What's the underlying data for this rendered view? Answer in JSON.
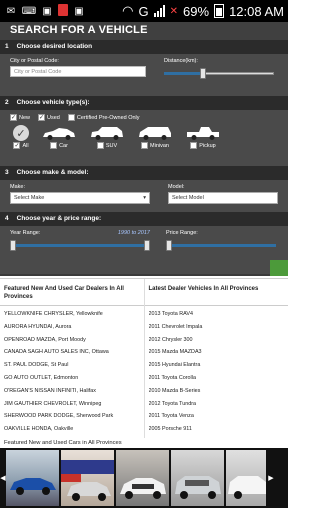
{
  "statusbar": {
    "network_label": "G",
    "battery_percent": "69%",
    "time": "12:08 AM"
  },
  "page_title": "SEARCH FOR A VEHICLE",
  "sections": {
    "location": {
      "number": "1",
      "title": "Choose desired location",
      "city_label": "City or Postal Code:",
      "city_placeholder": "City or Postal Code",
      "distance_label": "Distance(km):",
      "distance_level": 0.35
    },
    "type": {
      "number": "2",
      "title": "Choose vehicle type(s):",
      "checks": [
        {
          "label": "New",
          "checked": true
        },
        {
          "label": "Used",
          "checked": true
        },
        {
          "label": "Certified Pre-Owned Only",
          "checked": false
        }
      ],
      "vehicles": [
        {
          "label": "All",
          "icon": "all-check-icon",
          "checked": true
        },
        {
          "label": "Car",
          "icon": "car-icon",
          "checked": false
        },
        {
          "label": "SUV",
          "icon": "suv-icon",
          "checked": false
        },
        {
          "label": "Minivan",
          "icon": "minivan-icon",
          "checked": false
        },
        {
          "label": "Pickup",
          "icon": "pickup-icon",
          "checked": false
        }
      ]
    },
    "make": {
      "number": "3",
      "title": "Choose make & model:",
      "make_label": "Make:",
      "make_value": "Select Make",
      "model_label": "Model:",
      "model_value": "Select Model"
    },
    "price": {
      "number": "4",
      "title": "Choose year & price range:",
      "year_label": "Year Range:",
      "year_range": "1990 to 2017",
      "price_label": "Price Range:"
    }
  },
  "dealers": {
    "title": "Featured New And Used Car Dealers In All Provinces",
    "items": [
      "YELLOWKNIFE CHRYSLER, Yellowknife",
      "AURORA HYUNDAI, Aurora",
      "OPENROAD MAZDA, Port Moody",
      "CANADA SAGH AUTO SALES INC, Ottawa",
      "ST. PAUL DODGE, St Paul",
      "GO AUTO OUTLET, Edmonton",
      "O'REGAN'S NISSAN INFINITI, Halifax",
      "JIM GAUTHIER CHEVROLET, Winnipeg",
      "SHERWOOD PARK DODGE, Sherwood Park",
      "OAKVILLE HONDA, Oakville"
    ]
  },
  "latest": {
    "title": "Latest Dealer Vehicles In All Provinces",
    "items": [
      "2013 Toyota RAV4",
      "2011 Chevrolet Impala",
      "2012 Chrysler 300",
      "2015 Mazda MAZDA3",
      "2015 Hyundai Elantra",
      "2011 Toyota Corolla",
      "2010 Mazda B-Series",
      "2012 Toyota Tundra",
      "2011 Toyota Venza",
      "2005 Porsche 911"
    ]
  },
  "featured_cars_title": "Featured New and Used Cars in All Provinces",
  "colors": {
    "panel": "#3a3a3a",
    "accent_blue": "#2f6fa3",
    "search_green": "#4c9a3a"
  }
}
